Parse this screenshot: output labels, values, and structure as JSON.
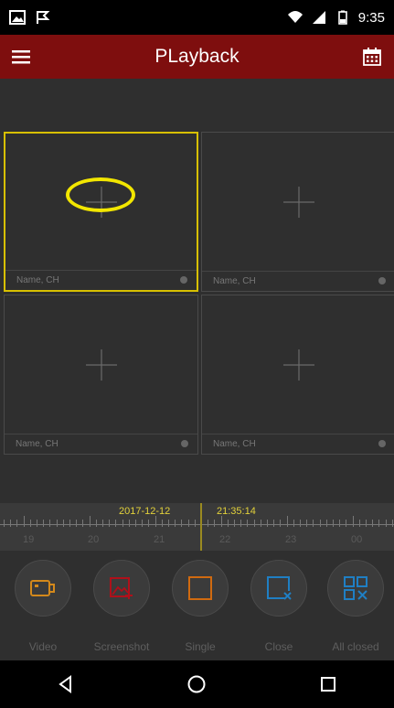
{
  "status_bar": {
    "time": "9:35"
  },
  "app_bar": {
    "title": "PLayback"
  },
  "grid": {
    "cells": [
      {
        "label": "Name, CH",
        "selected": true
      },
      {
        "label": "Name, CH",
        "selected": false
      },
      {
        "label": "Name, CH",
        "selected": false
      },
      {
        "label": "Name, CH",
        "selected": false
      }
    ]
  },
  "timeline": {
    "date": "2017-12-12",
    "time": "21:35:14",
    "hours": [
      "19",
      "20",
      "21",
      "22",
      "23",
      "00"
    ]
  },
  "actions": [
    {
      "label": "Video",
      "icon": "video-camera-icon",
      "color": "#d4891b"
    },
    {
      "label": "Screenshot",
      "icon": "screenshot-icon",
      "color": "#b0101a"
    },
    {
      "label": "Single",
      "icon": "single-view-icon",
      "color": "#d06a10"
    },
    {
      "label": "Close",
      "icon": "close-window-icon",
      "color": "#1f7fc4"
    },
    {
      "label": "All closed",
      "icon": "all-closed-icon",
      "color": "#1f7fc4"
    }
  ],
  "colors": {
    "app_bar": "#7e0e0e",
    "selection": "#d8c000",
    "highlight": "#f2e600",
    "timeline_text": "#e2d13a"
  }
}
